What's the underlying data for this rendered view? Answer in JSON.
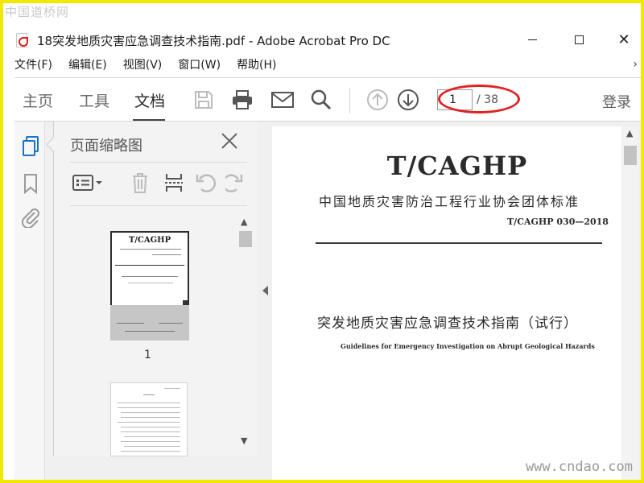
{
  "watermarks": {
    "top": "中国道桥网",
    "bottom": "www.cndao.com"
  },
  "window": {
    "title": "18突发地质灾害应急调查技术指南.pdf - Adobe Acrobat Pro DC",
    "close_glyph": "✕"
  },
  "menu": {
    "items": [
      "文件(F)",
      "编辑(E)",
      "视图(V)",
      "窗口(W)",
      "帮助(H)"
    ],
    "overflow_glyph": "›"
  },
  "toolbar": {
    "tabs": [
      "主页",
      "工具",
      "文档"
    ],
    "active_tab": "文档",
    "page_current": "1",
    "page_total": "/ 38",
    "login": "登录",
    "icons": [
      "save-icon",
      "print-icon",
      "email-icon",
      "search-icon",
      "page-up-icon",
      "page-down-icon"
    ]
  },
  "rail": {
    "icons": [
      "page-thumbnails-icon",
      "bookmark-icon",
      "attachment-icon"
    ]
  },
  "thumb_panel": {
    "title": "页面缩略图",
    "close_glyph": "✕",
    "tools": [
      "thumbnail-options-icon",
      "delete-page-icon",
      "insert-page-icon",
      "undo-icon",
      "redo-icon"
    ],
    "thumb1_header": "T/CAGHP",
    "page_label": "1",
    "scroll_up": "▲",
    "scroll_down": "▼"
  },
  "document": {
    "header": "T/CAGHP",
    "organization": "中国地质灾害防治工程行业协会团体标准",
    "standard_number": "T/CAGHP 030—2018",
    "title": "突发地质灾害应急调查技术指南（试行）",
    "english_title": "Guidelines for Emergency Investigation on Abrupt Geological Hazards",
    "scroll_up": "▲"
  },
  "colors": {
    "border_yellow": "#f3e800",
    "highlight_red": "#e02424",
    "pdf_red": "#d8231f",
    "disabled_icon": "#bcbcbc",
    "active_icon": "#555555",
    "rail_active": "#1a73c7"
  }
}
